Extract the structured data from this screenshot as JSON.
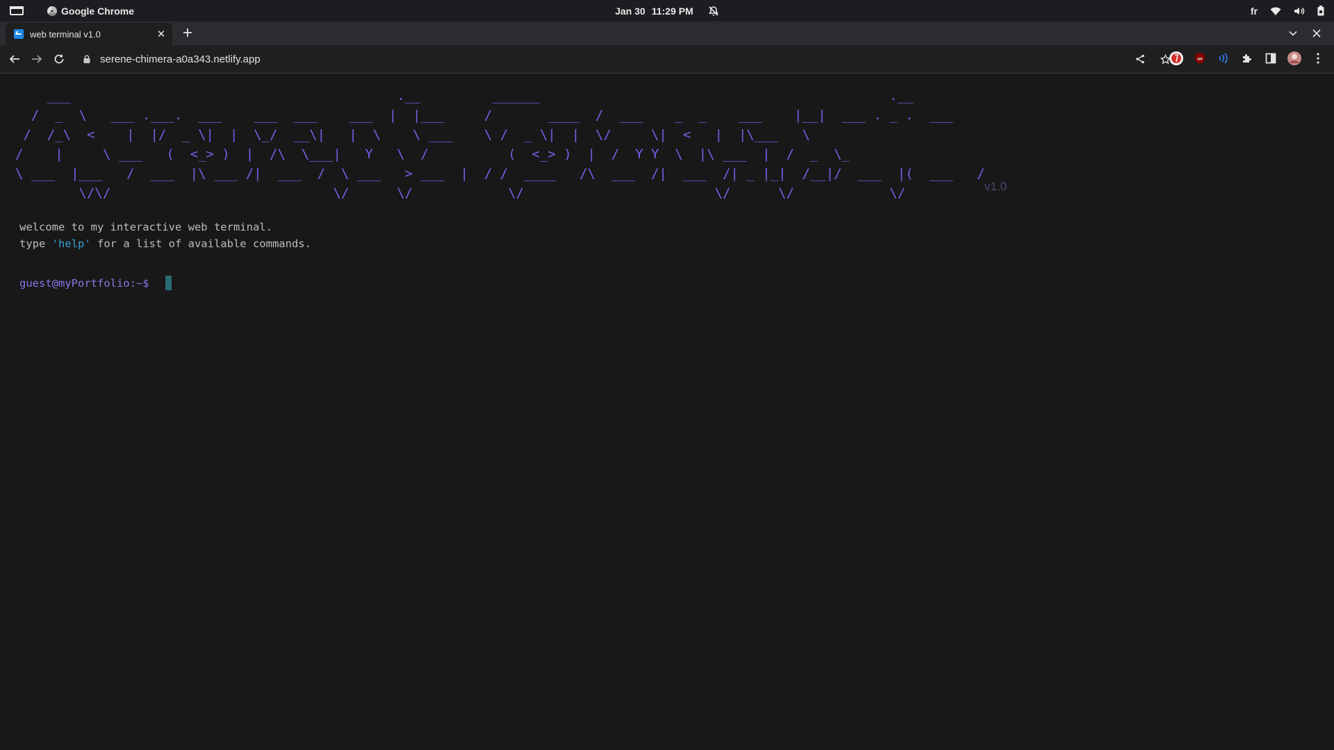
{
  "os_bar": {
    "app_name": "Google Chrome",
    "date": "Jan 30",
    "time": "11:29 PM",
    "keyboard_layout": "fr"
  },
  "browser": {
    "tab_title": "web terminal v1.0",
    "url": "serene-chimera-a0a343.netlify.app"
  },
  "terminal": {
    "ascii_banner": "    ___                                         .__         ______                                            .__\n  /  _  \\   ___ .___.  ___    ___  ___    ___  |  |___     /       ____  /  ___    _  _    ___    |__|  ___ . _ .  ___\n /  /_\\  <    |  |/  _ \\|  |  \\_/  __\\|   |  \\    \\ ___    \\ /  _ \\|  |  \\/     \\|  <   |  |\\___   \\\n/    |     \\ ___   (  <_> )  |  /\\  \\___|   Y   \\  /          (  <_> )  |  /  Y Y  \\  |\\ ___  |  /  _  \\_\n\\ ___  |___   /  ___  |\\ ___ /|  ___  /  \\ ___   > ___  |  / /  ____   /\\  ___  /|  ___  /| _ |_|  /__|/  ___  |(  ___   /\n        \\/\\/                            \\/      \\/            \\/                        \\/      \\/            \\/",
    "version": "v1.0",
    "welcome_line": "welcome to my interactive web terminal.",
    "help_line_prefix": "type ",
    "help_line_cmd": "'help'",
    "help_line_suffix": " for a list of available commands.",
    "prompt": "guest@myPortfolio:~$"
  },
  "colors": {
    "background": "#181818",
    "ascii": "#7a5ee8",
    "prompt": "#8e75e6",
    "help_highlight": "#3aa0d8",
    "cursor": "#2a6b73"
  }
}
